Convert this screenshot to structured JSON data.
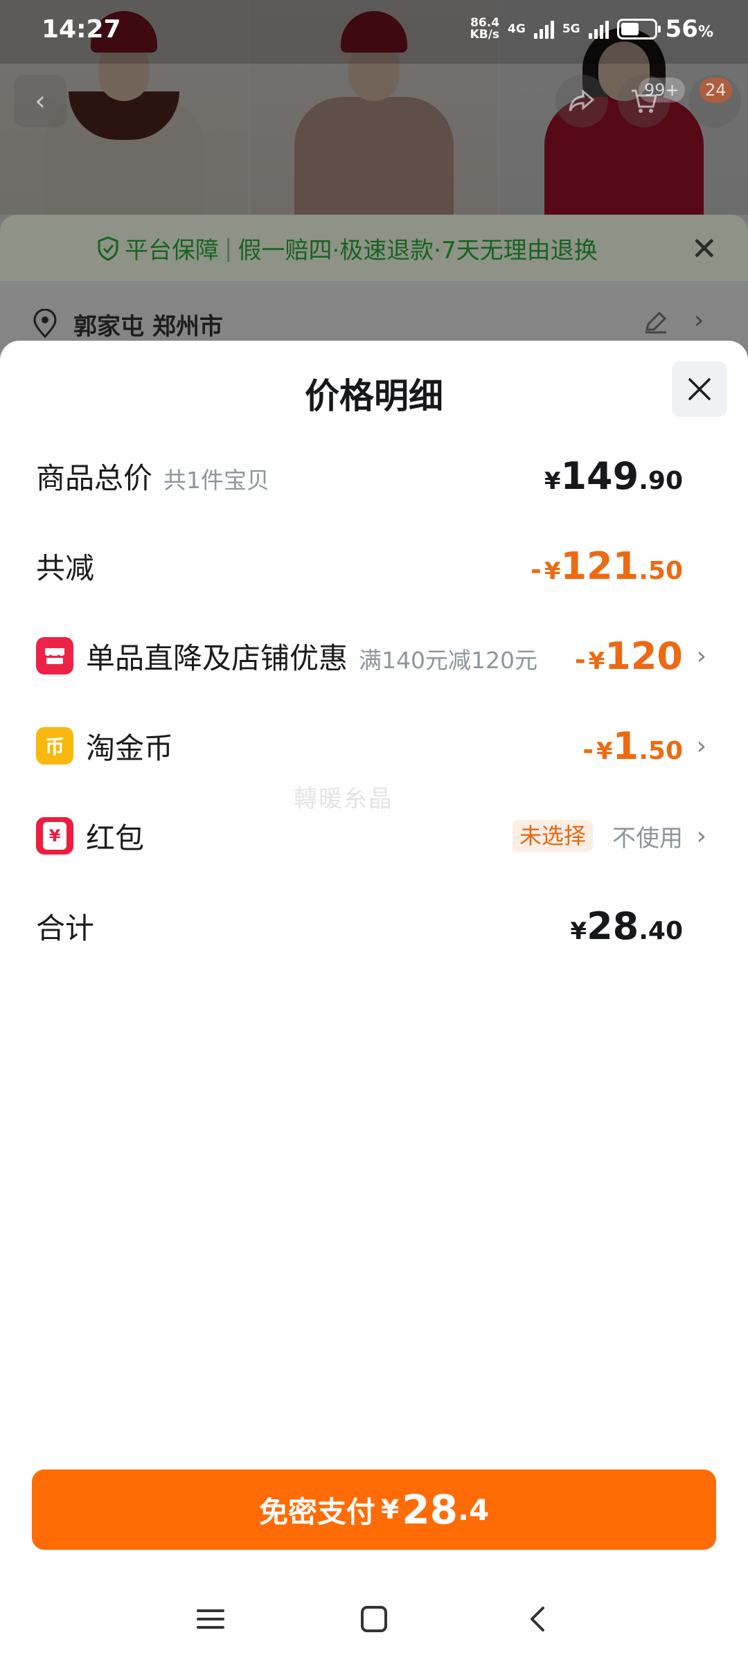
{
  "status_bar": {
    "time": "14:27",
    "net_speed_value": "86.4",
    "net_speed_unit": "KB/s",
    "net_4g": "4G",
    "net_5g": "5G",
    "battery_percent": "56",
    "battery_suffix": "%",
    "battery_level": 0.56
  },
  "background_page": {
    "cart_badge": "99+",
    "count_badge": "24",
    "guarantee": {
      "title": "平台保障",
      "separator": "|",
      "items": "假一赔四·极速退款·7天无理由退换"
    },
    "address": "郭家屯 郑州市"
  },
  "sheet": {
    "title": "价格明细",
    "rows": {
      "total": {
        "label": "商品总价",
        "sub": "共1件宝贝",
        "currency": "¥",
        "int": "149",
        "dec": ".90"
      },
      "reduction": {
        "label": "共减",
        "sign": "-",
        "currency": "¥",
        "int": "121",
        "dec": ".50"
      },
      "store_discount": {
        "label": "单品直降及店铺优惠",
        "sub": "满140元减120元",
        "sign": "-",
        "currency": "¥",
        "int": "120",
        "dec": ""
      },
      "taojinbi": {
        "label": "淘金币",
        "icon_glyph": "币",
        "sign": "-",
        "currency": "¥",
        "int": "1",
        "dec": ".50"
      },
      "hongbao": {
        "label": "红包",
        "icon_glyph": "¥",
        "tag": "未选择",
        "value": "不使用"
      },
      "sum": {
        "label": "合计",
        "currency": "¥",
        "int": "28",
        "dec": ".40"
      }
    },
    "watermark": "轉暖糸晶"
  },
  "pay_button": {
    "label": "免密支付",
    "currency": "¥",
    "int": "28",
    "dec": ".4"
  },
  "colors": {
    "accent_orange": "#ff6b04",
    "discount_orange": "#ed6a12",
    "guarantee_green": "#17641f"
  }
}
